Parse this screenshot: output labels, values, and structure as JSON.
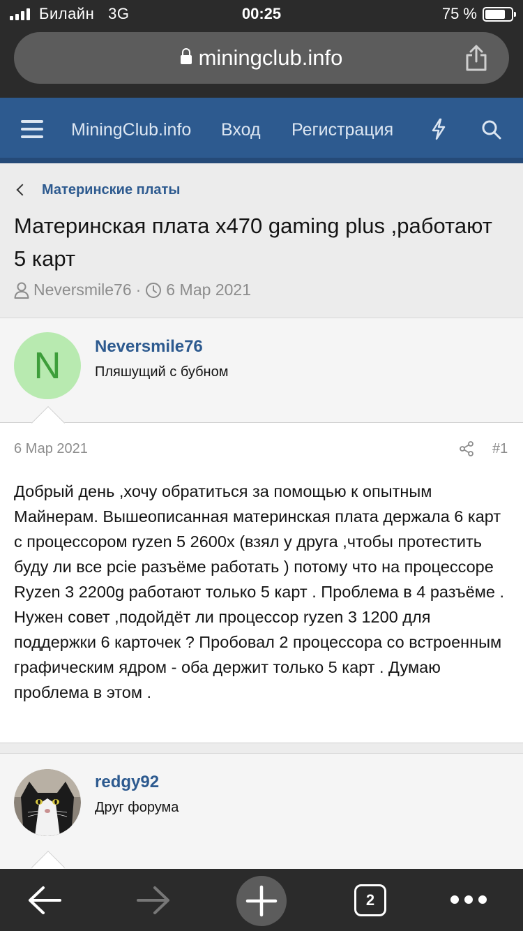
{
  "status_bar": {
    "carrier": "Билайн",
    "network": "3G",
    "time": "00:25",
    "battery": "75 %"
  },
  "browser": {
    "url": "miningclub.info",
    "open_tabs": "2"
  },
  "site_nav": {
    "logo": "MiningClub.info",
    "login": "Вход",
    "register": "Регистрация"
  },
  "thread": {
    "breadcrumb": "Материнские платы",
    "title": "Материнская плата x470 gaming plus ,работают 5 карт",
    "author": "Neversmile76",
    "date": "6 Мар 2021"
  },
  "posts": [
    {
      "avatar_letter": "N",
      "username": "Neversmile76",
      "user_title": "Пляшущий с бубном",
      "date": "6 Мар 2021",
      "number": "#1",
      "text": "Добрый день ,хочу обратиться за помощью к опытным Майнерам. Вышеописанная материнская плата держала 6 карт с процессором ryzen 5 2600x (взял у друга ,чтобы протестить буду ли все pcie разъёме работать ) потому что на процессоре Ryzen 3 2200g работают только 5 карт . Проблема в 4 разъёме . Нужен совет ,подойдёт ли процессор ryzen 3 1200 для поддержки 6 карточек ? Пробовал 2 процессора со встроенным графическим ядром - оба держит только 5 карт . Думаю проблема в этом ."
    },
    {
      "username": "redgy92",
      "user_title": "Друг форума"
    }
  ],
  "colors": {
    "accent": "#2d5a8f",
    "avatar_bg": "#b8eab0",
    "avatar_fg": "#3d9e3a"
  }
}
